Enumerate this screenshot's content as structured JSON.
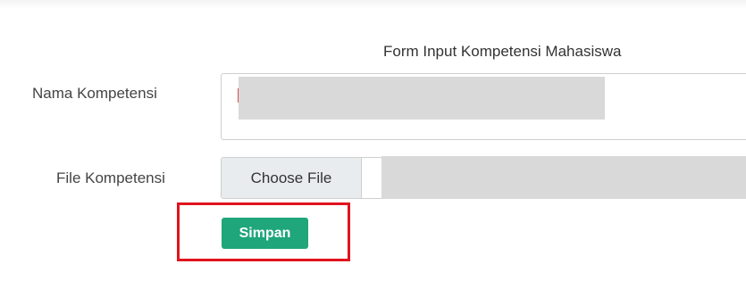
{
  "form": {
    "title": "Form Input Kompetensi Mahasiswa",
    "nama_label": "Nama Kompetensi",
    "file_label": "File Kompetensi",
    "choose_file_label": "Choose File",
    "save_label": "Simpan"
  },
  "colors": {
    "save_button": "#1fa67a",
    "highlight_border": "#e0141e",
    "redaction": "#d9d9d9"
  },
  "icons": {
    "text_caret": "red-caret-icon"
  }
}
